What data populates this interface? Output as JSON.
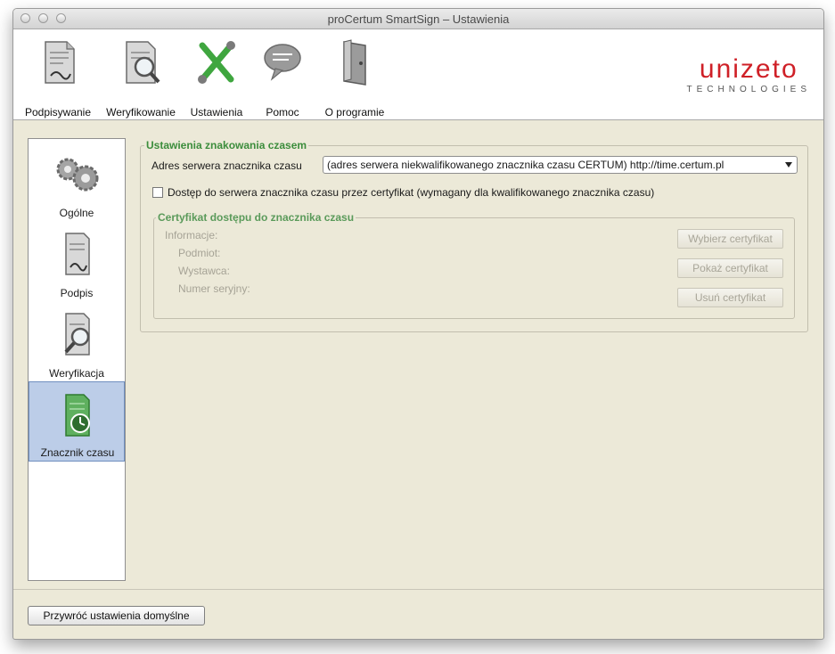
{
  "window": {
    "title": "proCertum SmartSign – Ustawienia"
  },
  "toolbar": {
    "items": [
      {
        "label": "Podpisywanie",
        "icon": "sign-document-icon"
      },
      {
        "label": "Weryfikowanie",
        "icon": "verify-document-icon"
      },
      {
        "label": "Ustawienia",
        "icon": "settings-tools-icon"
      },
      {
        "label": "Pomoc",
        "icon": "help-bubble-icon"
      },
      {
        "label": "O programie",
        "icon": "about-door-icon"
      }
    ]
  },
  "logo": {
    "main": "unizeto",
    "sub": "TECHNOLOGIES",
    "color": "#cf2027"
  },
  "sidebar": {
    "items": [
      {
        "label": "Ogólne",
        "icon": "gears-icon",
        "selected": false
      },
      {
        "label": "Podpis",
        "icon": "signature-document-icon",
        "selected": false
      },
      {
        "label": "Weryfikacja",
        "icon": "verification-magnifier-icon",
        "selected": false
      },
      {
        "label": "Znacznik czasu",
        "icon": "timestamp-clock-icon",
        "selected": true
      }
    ]
  },
  "timestamp_settings": {
    "legend": "Ustawienia znakowania czasem",
    "server_label": "Adres serwera znacznika czasu",
    "server_value": "(adres serwera niekwalifikowanego znacznika czasu CERTUM) http://time.certum.pl",
    "cert_access_checkbox_label": "Dostęp do serwera znacznika czasu przez certyfikat (wymagany dla kwalifikowanego znacznika czasu)",
    "cert_access_checked": false
  },
  "certificate": {
    "legend": "Certyfikat dostępu do znacznika czasu",
    "info_label": "Informacje:",
    "subject_label": "Podmiot:",
    "issuer_label": "Wystawca:",
    "serial_label": "Numer seryjny:",
    "choose_button": "Wybierz certyfikat",
    "show_button": "Pokaż certyfikat",
    "remove_button": "Usuń certyfikat"
  },
  "footer": {
    "restore_defaults_button": "Przywróć ustawienia domyślne"
  }
}
